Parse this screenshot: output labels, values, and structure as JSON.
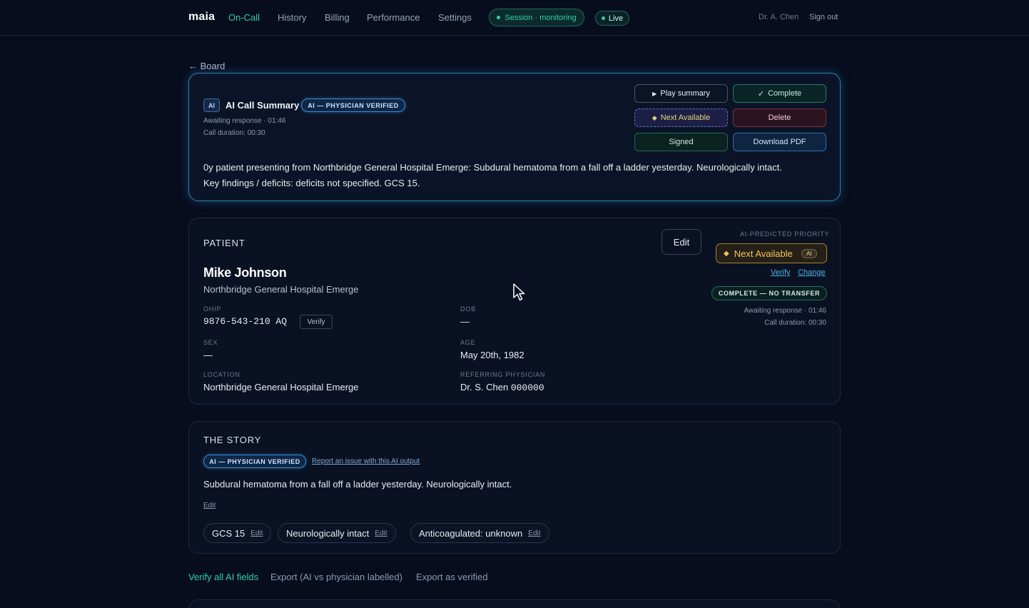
{
  "nav": {
    "brand": "maia",
    "items": [
      "On-Call",
      "History",
      "Billing",
      "Performance",
      "Settings"
    ],
    "session_pill": "Session · monitoring",
    "live_pill": "Live",
    "user": "Dr. A. Chen",
    "signout": "Sign out"
  },
  "back_link": "← Board",
  "ai_summary": {
    "badge": "AI",
    "title": "AI Call Summary",
    "verified_badge": "AI — PHYSICIAN VERIFIED",
    "awaiting": "Awaiting response · 01:46",
    "duration": "Call duration: 00:30",
    "text_line1": "0y patient presenting from Northbridge General Hospital Emerge: Subdural hematoma from a fall off a ladder yesterday. Neurologically intact.",
    "text_line2": "Key findings / deficits: deficits not specified. GCS 15.",
    "buttons": {
      "play": "Play summary",
      "play_icon": "▶",
      "complete": "Complete",
      "complete_icon": "✓",
      "next_available": "Next Available",
      "next_icon": "◆",
      "delete": "Delete",
      "signed": "Signed",
      "download": "Download PDF"
    }
  },
  "patient": {
    "section_title": "PATIENT",
    "edit": "Edit",
    "name": "Mike Johnson",
    "hospital": "Northbridge General Hospital Emerge",
    "fields": {
      "ohip_label": "OHIP",
      "ohip_value": "9876-543-210 AQ",
      "verify": "Verify",
      "dob_label": "DOB",
      "dob_value": "—",
      "sex_label": "SEX",
      "sex_value": "—",
      "age_label": "AGE",
      "age_value": "May 20th, 1982",
      "location_label": "LOCATION",
      "location_value": "Northbridge General Hospital Emerge",
      "referring_label": "REFERRING PHYSICIAN",
      "referring_name": "Dr. S. Chen",
      "referring_id": "000000"
    },
    "priority": {
      "label": "AI-PREDICTED PRIORITY",
      "value": "Next Available",
      "icon": "◆",
      "ai_tag": "AI",
      "verify_link": "Verify",
      "change_link": "Change",
      "status_pill": "COMPLETE — NO TRANSFER",
      "awaiting": "Awaiting response · 01:46",
      "duration": "Call duration: 00:30"
    }
  },
  "story": {
    "section_title": "THE STORY",
    "verified_badge": "AI — PHYSICIAN VERIFIED",
    "report_link": "Report an issue with this AI output",
    "text": "Subdural hematoma from a fall off a ladder yesterday. Neurologically intact.",
    "edit": "Edit",
    "chips": [
      {
        "label": "GCS 15",
        "edit": "Edit"
      },
      {
        "label": "Neurologically intact",
        "edit": "Edit"
      },
      {
        "label": "Anticoagulated: unknown",
        "edit": "Edit"
      }
    ]
  },
  "bottom_links": {
    "verify_all": "Verify all AI fields",
    "export_labelled": "Export (AI vs physician labelled)",
    "export_verified": "Export as verified"
  },
  "colors": {
    "accent": "#2fd1a6",
    "ai_blue": "#3a8fd8",
    "priority_gold": "#f2c55b",
    "background": "#070d1d"
  }
}
